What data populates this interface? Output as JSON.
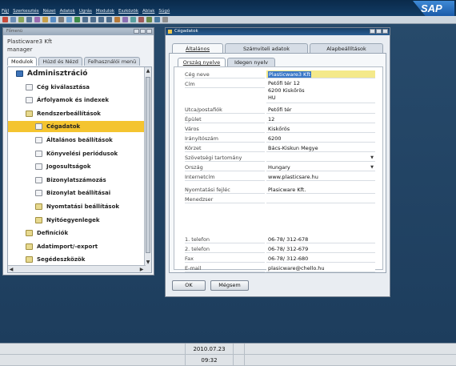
{
  "menubar": {
    "items": [
      "Fájl",
      "Szerkesztés",
      "Nézet",
      "Adatok",
      "Ugrás",
      "Modulok",
      "Eszközök",
      "Ablak",
      "Súgó"
    ],
    "logo_text": "SAP"
  },
  "menu_window": {
    "title": "Főmenü",
    "company": "Plasticware3 Kft",
    "user": "manager",
    "tabs": [
      "Modulok",
      "Húzd és Nézd",
      "Felhasználói menü"
    ],
    "tree": [
      {
        "label": "Adminisztráció",
        "level": 0,
        "icon": "admin-icon"
      },
      {
        "label": "Cég kiválasztása",
        "level": 1,
        "icon": "document-icon"
      },
      {
        "label": "Árfolyamok és indexek",
        "level": 1,
        "icon": "document-icon"
      },
      {
        "label": "Rendszerbeállítások",
        "level": 1,
        "icon": "folder-icon"
      },
      {
        "label": "Cégadatok",
        "level": 2,
        "icon": "document-icon",
        "selected": true
      },
      {
        "label": "Általános beállítások",
        "level": 2,
        "icon": "document-icon"
      },
      {
        "label": "Könyvelési periódusok",
        "level": 2,
        "icon": "document-icon"
      },
      {
        "label": "Jogosultságok",
        "level": 2,
        "icon": "document-icon"
      },
      {
        "label": "Bizonylatszámozás",
        "level": 2,
        "icon": "document-icon"
      },
      {
        "label": "Bizonylat beállításai",
        "level": 2,
        "icon": "document-icon"
      },
      {
        "label": "Nyomtatási beállítások",
        "level": 2,
        "icon": "folder-icon"
      },
      {
        "label": "Nyitóegyenlegek",
        "level": 2,
        "icon": "folder-icon"
      },
      {
        "label": "Definíciók",
        "level": 1,
        "icon": "folder-icon"
      },
      {
        "label": "Adatimport/-export",
        "level": 1,
        "icon": "folder-icon"
      },
      {
        "label": "Segédeszközök",
        "level": 1,
        "icon": "folder-icon"
      }
    ]
  },
  "company_window": {
    "title": "Cégadatok",
    "tabs": [
      "Általános",
      "Számviteli adatok",
      "Alapbeállítások"
    ],
    "subtabs": [
      "Ország nyelve",
      "Idegen nyelv"
    ],
    "fields": [
      {
        "label": "Cég neve",
        "value": "Plasticware3 Kft"
      },
      {
        "label": "Cím",
        "value": [
          "Petőfi tér 12",
          "6200 Kiskőrös",
          "HU"
        ]
      },
      {
        "label": "Utca/postafiók",
        "value": "Petőfi tér"
      },
      {
        "label": "Épület",
        "value": "12"
      },
      {
        "label": "Város",
        "value": "Kiskőrös"
      },
      {
        "label": "Irányítószám",
        "value": "6200"
      },
      {
        "label": "Körzet",
        "value": "Bács-Kiskun Megye"
      },
      {
        "label": "Szövetségi tartomány",
        "value": ""
      },
      {
        "label": "Ország",
        "value": "Hungary"
      },
      {
        "label": "Internetcím",
        "value": "www.plasticsare.hu"
      },
      {
        "label": "Nyomtatási fejléc",
        "value": "Plasicware Kft."
      },
      {
        "label": "Menedzser",
        "value": ""
      },
      {
        "label": "1. telefon",
        "value": "06-78/ 312-678"
      },
      {
        "label": "2. telefon",
        "value": "06-78/ 312-679"
      },
      {
        "label": "Fax",
        "value": "06-78/ 312-680"
      },
      {
        "label": "E-mail",
        "value": "plasicware@chello.hu"
      }
    ],
    "ok_label": "OK",
    "cancel_label": "Mégsem"
  },
  "status": {
    "date": "2010.07.23",
    "time": "09:32"
  }
}
